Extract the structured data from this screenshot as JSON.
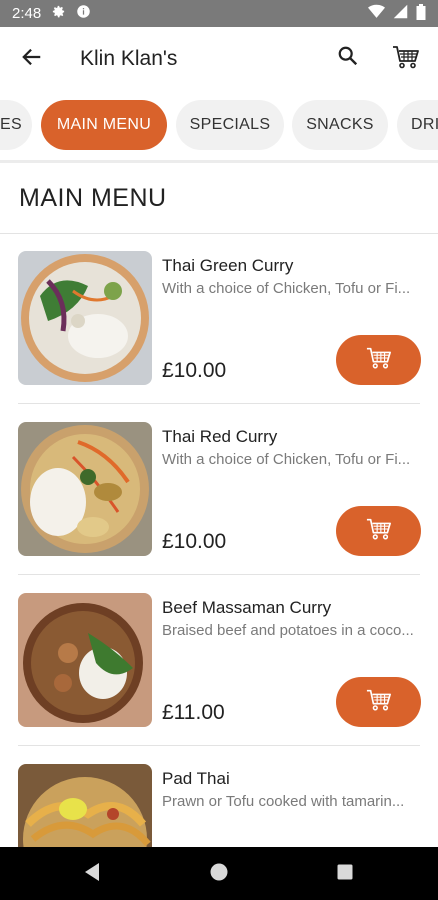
{
  "status_bar": {
    "time": "2:48",
    "icons": [
      "gear-icon",
      "info-icon",
      "wifi-icon",
      "signal-icon",
      "battery-icon"
    ]
  },
  "app_bar": {
    "title": "Klin Klan's",
    "icons": [
      "back-arrow-icon",
      "search-icon",
      "cart-icon"
    ]
  },
  "tabs": [
    {
      "label": "ES",
      "active": false
    },
    {
      "label": "MAIN MENU",
      "active": true
    },
    {
      "label": "SPECIALS",
      "active": false
    },
    {
      "label": "SNACKS",
      "active": false
    },
    {
      "label": "DRI",
      "active": false
    }
  ],
  "section": {
    "title": "MAIN MENU"
  },
  "items": [
    {
      "name": "Thai Green Curry",
      "description": "With a choice of Chicken, Tofu or Fi...",
      "price": "£10.00"
    },
    {
      "name": "Thai Red Curry",
      "description": "With a choice of Chicken, Tofu or Fi...",
      "price": "£10.00"
    },
    {
      "name": "Beef Massaman Curry",
      "description": "Braised beef and potatoes in a coco...",
      "price": "£11.00"
    },
    {
      "name": "Pad Thai",
      "description": "Prawn or Tofu cooked with tamarin...",
      "price": ""
    }
  ],
  "colors": {
    "accent": "#d9622b",
    "status_bar": "#7a7a7a",
    "tab_inactive": "#f1f1f1",
    "nav_bar": "#000000"
  },
  "nav_bar": {
    "icons": [
      "back-triangle-icon",
      "home-circle-icon",
      "recents-square-icon"
    ]
  }
}
